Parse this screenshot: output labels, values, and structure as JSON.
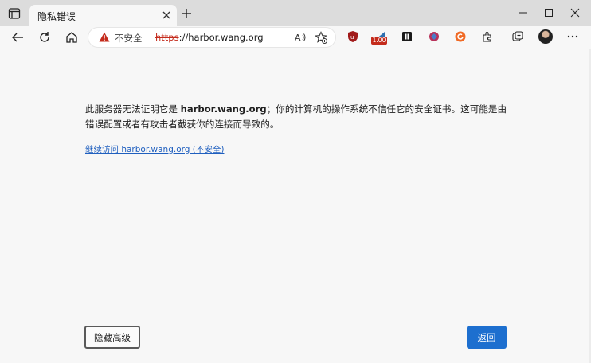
{
  "tab": {
    "title": "隐私错误"
  },
  "address_bar": {
    "security_label": "不安全",
    "url_scheme": "https",
    "url_rest": "://harbor.wang.org"
  },
  "extensions": {
    "badge_text": "1.00"
  },
  "error_page": {
    "message_prefix": "此服务器无法证明它是 ",
    "message_host": "harbor.wang.org",
    "message_suffix": "；你的计算机的操作系统不信任它的安全证书。这可能是由错误配置或者有攻击者截获你的连接而导致的。",
    "continue_link": "继续访问 harbor.wang.org (不安全)",
    "advanced_button": "隐藏高级",
    "back_button": "返回"
  },
  "colors": {
    "accent": "#1d6fcf",
    "warning": "#c42b1c",
    "link": "#1f5fbf"
  },
  "icons": [
    "tab-actions-icon",
    "close-icon",
    "plus-icon",
    "minimize-icon",
    "maximize-icon",
    "close-window-icon",
    "back-arrow-icon",
    "refresh-icon",
    "home-icon",
    "warning-icon",
    "read-aloud-icon",
    "favorite-star-icon",
    "extension-icon",
    "collections-icon",
    "more-dots-icon"
  ]
}
